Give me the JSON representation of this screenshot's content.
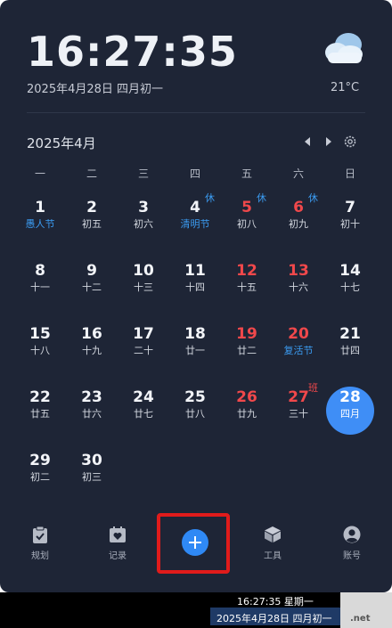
{
  "clock": {
    "time": "16:27:35",
    "date_line": "2025年4月28日 四月初一"
  },
  "weather": {
    "icon": "cloudy-icon",
    "temperature": "21°C"
  },
  "calendar": {
    "month_title": "2025年4月",
    "weekdays": [
      "一",
      "二",
      "三",
      "四",
      "五",
      "六",
      "日"
    ],
    "days": [
      {
        "num": "1",
        "sub": "愚人节",
        "holiday": true
      },
      {
        "num": "2",
        "sub": "初五"
      },
      {
        "num": "3",
        "sub": "初六"
      },
      {
        "num": "4",
        "sub": "清明节",
        "holiday": true,
        "badge": "休"
      },
      {
        "num": "5",
        "sub": "初八",
        "weekend": true,
        "badge": "休"
      },
      {
        "num": "6",
        "sub": "初九",
        "weekend": true,
        "badge": "休"
      },
      {
        "num": "7",
        "sub": "初十"
      },
      {
        "num": "8",
        "sub": "十一"
      },
      {
        "num": "9",
        "sub": "十二"
      },
      {
        "num": "10",
        "sub": "十三"
      },
      {
        "num": "11",
        "sub": "十四"
      },
      {
        "num": "12",
        "sub": "十五",
        "weekend": true
      },
      {
        "num": "13",
        "sub": "十六",
        "weekend": true
      },
      {
        "num": "14",
        "sub": "十七"
      },
      {
        "num": "15",
        "sub": "十八"
      },
      {
        "num": "16",
        "sub": "十九"
      },
      {
        "num": "17",
        "sub": "二十"
      },
      {
        "num": "18",
        "sub": "廿一"
      },
      {
        "num": "19",
        "sub": "廿二",
        "weekend": true
      },
      {
        "num": "20",
        "sub": "复活节",
        "weekend": true,
        "holiday": true
      },
      {
        "num": "21",
        "sub": "廿四"
      },
      {
        "num": "22",
        "sub": "廿五"
      },
      {
        "num": "23",
        "sub": "廿六"
      },
      {
        "num": "24",
        "sub": "廿七"
      },
      {
        "num": "25",
        "sub": "廿八"
      },
      {
        "num": "26",
        "sub": "廿九",
        "weekend": true
      },
      {
        "num": "27",
        "sub": "三十",
        "weekend": true,
        "badge": "班",
        "badge_type": "work"
      },
      {
        "num": "28",
        "sub": "四月",
        "today": true
      },
      {
        "num": "29",
        "sub": "初二"
      },
      {
        "num": "30",
        "sub": "初三"
      }
    ],
    "first_weekday_offset": 1
  },
  "bottom_nav": {
    "plan_label": "规划",
    "record_label": "记录",
    "tools_label": "工具",
    "account_label": "账号"
  },
  "taskbar": {
    "time": "16:27:35 星期一",
    "date": "2025年4月28日 四月初一",
    "watermark": ".net"
  },
  "colors": {
    "panel_bg": "#1e2536",
    "accent": "#3f8ef6",
    "weekend": "#f0484b",
    "holiday": "#3b9cf2",
    "highlight": "#e01b1b"
  }
}
